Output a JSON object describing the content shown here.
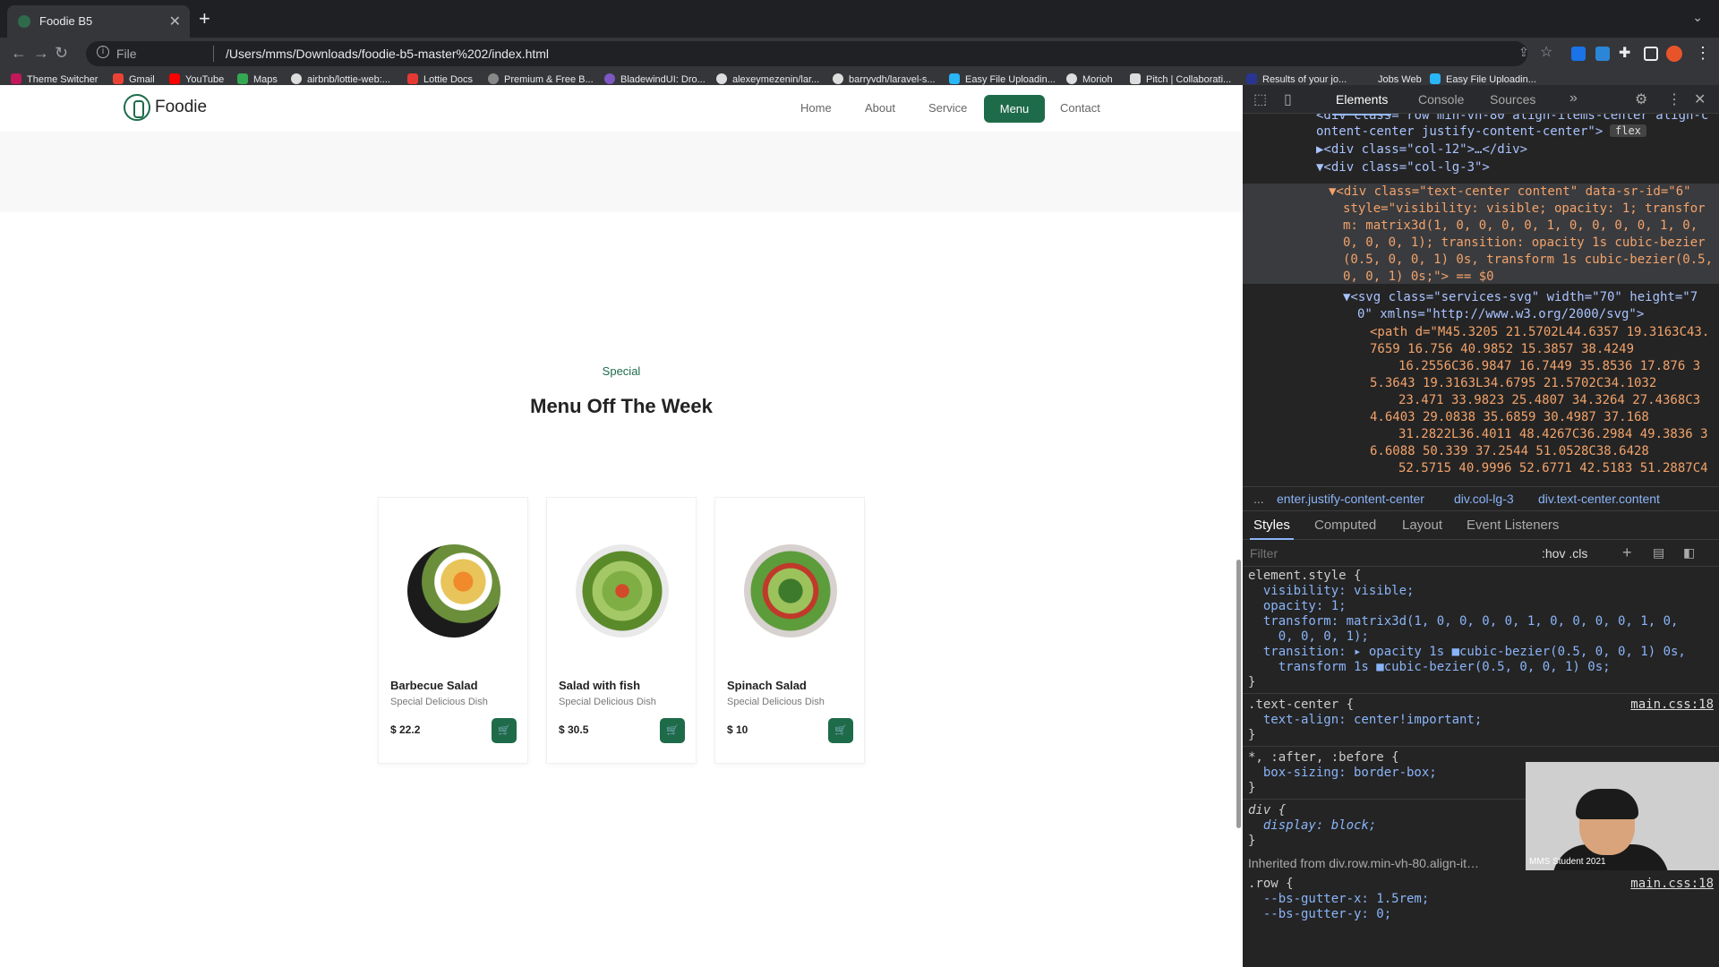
{
  "browser": {
    "tab_title": "Foodie B5",
    "address_prefix": "File",
    "url": "/Users/mms/Downloads/foodie-b5-master%202/index.html",
    "bookmarks": [
      "Theme Switcher",
      "Gmail",
      "YouTube",
      "Maps",
      "airbnb/lottie-web:...",
      "Lottie Docs",
      "Premium & Free B...",
      "BladewindUI: Dro...",
      "alexeymezenin/lar...",
      "barryvdh/laravel-s...",
      "Easy File Uploadin...",
      "Morioh",
      "Pitch | Collaborati...",
      "Results of your jo...",
      "Jobs Web",
      "Easy File Uploadin..."
    ]
  },
  "site": {
    "brand": "Foodie",
    "nav": [
      "Home",
      "About",
      "Service",
      "Menu",
      "Contact"
    ],
    "active_nav": "Menu",
    "section_label": "Special",
    "section_title": "Menu Off The Week",
    "items": [
      {
        "name": "Barbecue Salad",
        "subtitle": "Special Delicious Dish",
        "price": "$ 22.2"
      },
      {
        "name": "Salad with fish",
        "subtitle": "Special Delicious Dish",
        "price": "$ 30.5"
      },
      {
        "name": "Spinach Salad",
        "subtitle": "Special Delicious Dish",
        "price": "$ 10"
      }
    ]
  },
  "devtools": {
    "tabs": [
      "Elements",
      "Console",
      "Sources"
    ],
    "elements": [
      "<div class=\"row min-vh-80 align-items-center align-c",
      "ontent-center justify-content-center\">",
      "▶<div class=\"col-12\">…</div>",
      "▼<div class=\"col-lg-3\">",
      "▼<div class=\"text-center content\" data-sr-id=\"6\"",
      "style=\"visibility: visible; opacity: 1; transfor",
      "m: matrix3d(1, 0, 0, 0, 0, 1, 0, 0, 0, 0, 1, 0,",
      "0, 0, 0, 1); transition: opacity 1s cubic-bezier",
      "(0.5, 0, 0, 1) 0s, transform 1s cubic-bezier(0.5,",
      "0, 0, 1) 0s;\"> == $0",
      "▼<svg class=\"services-svg\" width=\"70\" height=\"7",
      "0\" xmlns=\"http://www.w3.org/2000/svg\">",
      "<path d=\"M45.3205 21.5702L44.6357 19.3163C43.",
      "7659 16.756 40.9852 15.3857 38.4249",
      "16.2556C36.9847 16.7449 35.8536 17.876 3",
      "5.3643 19.3163L34.6795 21.5702C34.1032",
      "23.471 33.9823 25.4807 34.3264 27.4368C3",
      "4.6403 29.0838 35.6859 30.4987 37.168",
      "31.2822L36.4011 48.4267C36.2984 49.3836 3",
      "6.6088 50.339 37.2544 51.0528C38.6428",
      "52.5715 40.9996 52.6771 42.5183 51.2887C4"
    ],
    "flex_badge": "flex",
    "breadcrumbs": [
      "...",
      "enter.justify-content-center",
      "div.col-lg-3",
      "div.text-center.content"
    ],
    "style_tabs": [
      "Styles",
      "Computed",
      "Layout",
      "Event Listeners"
    ],
    "filter_placeholder": "Filter",
    "filter_tools": ":hov .cls",
    "styles": [
      "element.style {",
      "  visibility: visible;",
      "  opacity: 1;",
      "  transform: matrix3d(1, 0, 0, 0, 0, 1, 0, 0, 0, 0, 1, 0,",
      "    0, 0, 0, 1);",
      "  transition: ▸ opacity 1s ■cubic-bezier(0.5, 0, 0, 1) 0s,",
      "    transform 1s ■cubic-bezier(0.5, 0, 0, 1) 0s;",
      "}",
      ".text-center {",
      "  text-align: center!important;",
      "}",
      "*, :after, :before {",
      "  box-sizing: border-box;",
      "}",
      "div {",
      "  display: block;",
      "}",
      "Inherited from div.row.min-vh-80.align-it…",
      ".row {",
      "  --bs-gutter-x: 1.5rem;",
      "  --bs-gutter-y: 0;"
    ],
    "source_link": "main.css:18",
    "webcam_label": "MMS Student 2021"
  },
  "colors": {
    "brand_green": "#1e6b4a",
    "devtools_bg": "#242424",
    "chrome_bg": "#35363a"
  }
}
